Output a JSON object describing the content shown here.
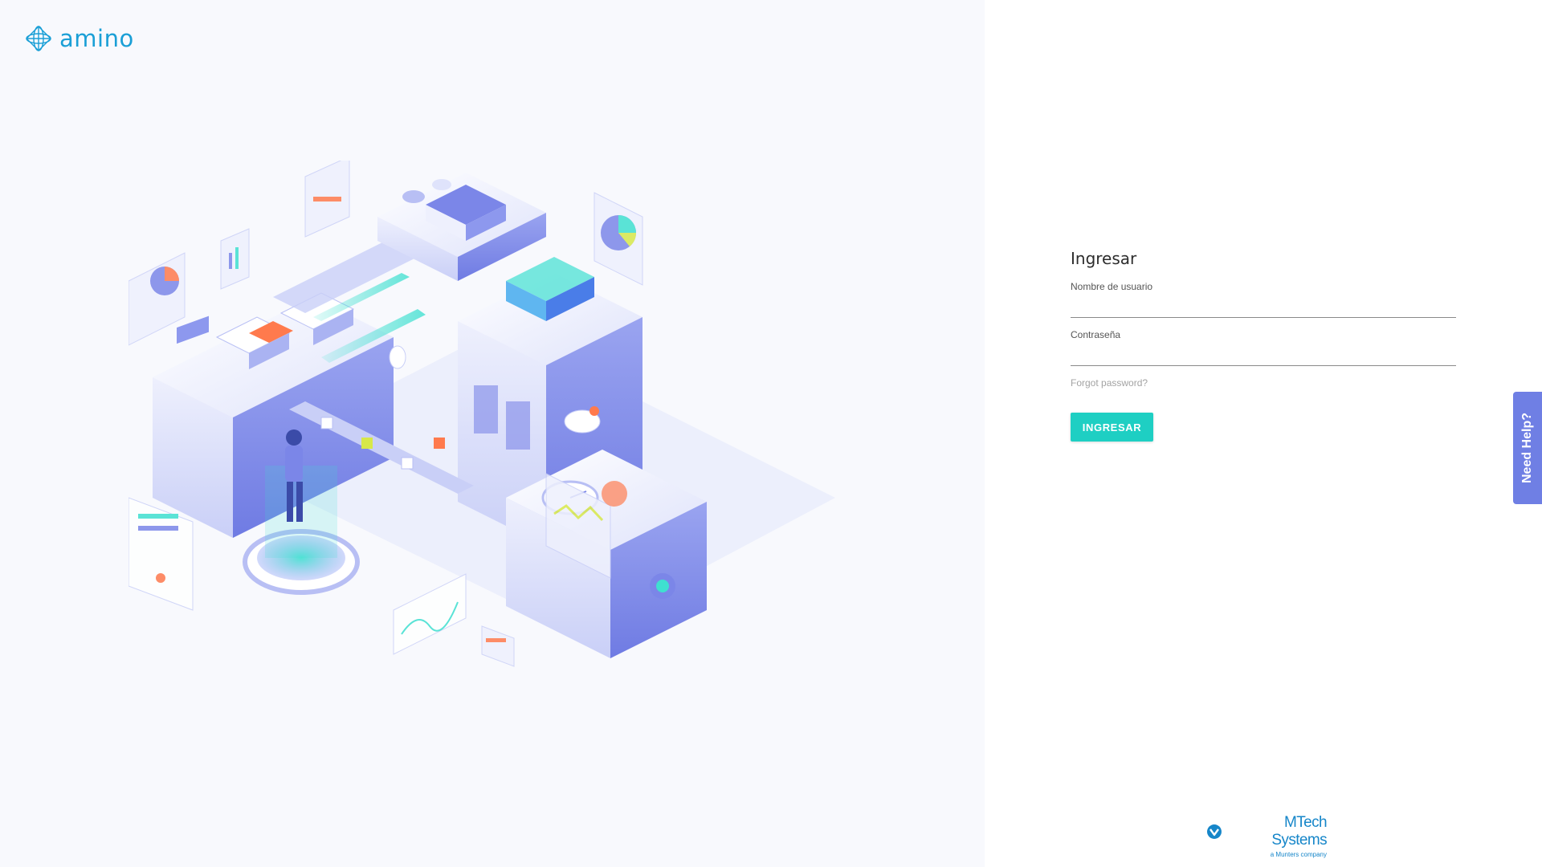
{
  "app": {
    "logo_text": "amino"
  },
  "login": {
    "title": "Ingresar",
    "username_label": "Nombre de usuario",
    "username_value": "",
    "password_label": "Contraseña",
    "password_value": "",
    "forgot_link": "Forgot password?",
    "submit_label": "INGRESAR"
  },
  "help": {
    "tab_label": "Need Help?"
  },
  "footer": {
    "brand_name": "MTech Systems",
    "brand_tagline": "a Munters company"
  },
  "colors": {
    "accent": "#1ecfc3",
    "logo": "#1a9fd6",
    "help_tab": "#6f7fe4",
    "brand": "#1686c9",
    "illustration_primary": "#7b86e8"
  }
}
